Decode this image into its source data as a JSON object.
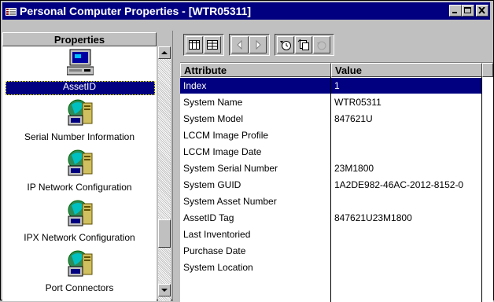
{
  "window": {
    "title": "Personal Computer Properties - [WTR05311]"
  },
  "left": {
    "header": "Properties",
    "items": [
      {
        "label": "AssetID",
        "icon": "assetid-computer-icon",
        "selected": true
      },
      {
        "label": "Serial Number Information",
        "icon": "network-computer-icon"
      },
      {
        "label": "IP Network Configuration",
        "icon": "network-computer-icon"
      },
      {
        "label": "IPX Network Configuration",
        "icon": "network-computer-icon"
      },
      {
        "label": "Port Connectors",
        "icon": "network-computer-icon"
      }
    ]
  },
  "toolbar": {
    "icons": [
      "table-view-icon",
      "grid-view-icon",
      "previous-icon",
      "next-icon",
      "refresh-clock-icon",
      "copy-icon",
      "undo-icon"
    ]
  },
  "grid": {
    "columns": [
      "Attribute",
      "Value"
    ],
    "rows": [
      {
        "attribute": "Index",
        "value": "1"
      },
      {
        "attribute": "System Name",
        "value": "WTR05311"
      },
      {
        "attribute": "System Model",
        "value": "847621U"
      },
      {
        "attribute": "LCCM Image Profile",
        "value": ""
      },
      {
        "attribute": "LCCM Image Date",
        "value": ""
      },
      {
        "attribute": "System Serial Number",
        "value": "23M1800"
      },
      {
        "attribute": "System GUID",
        "value": "1A2DE982-46AC-2012-8152-0"
      },
      {
        "attribute": "System Asset Number",
        "value": ""
      },
      {
        "attribute": "AssetID Tag",
        "value": "847621U23M1800"
      },
      {
        "attribute": "Last Inventoried",
        "value": ""
      },
      {
        "attribute": "Purchase Date",
        "value": ""
      },
      {
        "attribute": "System Location",
        "value": ""
      }
    ]
  },
  "colors": {
    "titlebar": "#000080",
    "selection": "#000080",
    "face": "#c0c0c0"
  }
}
